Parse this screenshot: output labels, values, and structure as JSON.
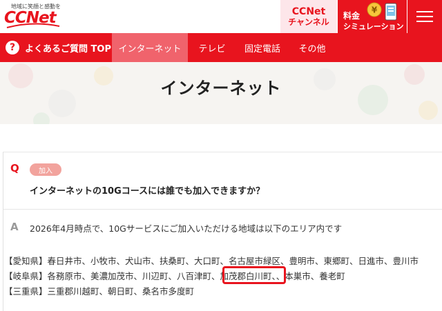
{
  "header": {
    "logo_tagline": "地域に笑顔と感動を",
    "logo_text": "CCNet",
    "channel_line1": "CCNet",
    "channel_line2": "チャンネル",
    "sim_line1": "料金",
    "sim_line2": "シミュレーション",
    "coin_symbol": "¥"
  },
  "nav": {
    "home_icon": "?",
    "home_label": "よくあるご質問 TOP",
    "items": [
      {
        "label": "インターネット",
        "active": true
      },
      {
        "label": "テレビ",
        "active": false
      },
      {
        "label": "固定電話",
        "active": false
      },
      {
        "label": "その他",
        "active": false
      }
    ]
  },
  "hero": {
    "title": "インターネット"
  },
  "faq": {
    "q_mark": "Q",
    "badge": "加入",
    "question": "インターネットの10Gコースには誰でも加入できますか？",
    "a_mark": "A",
    "answer": "2026年4月時点で、10Gサービスにご加入いただける地域は以下のエリア内です",
    "areas": [
      "【愛知県】春日井市、小牧市、犬山市、扶桑町、大口町、名古屋市緑区、豊明市、東郷町、日進市、豊川市",
      "【岐阜県】各務原市、美濃加茂市、川辺町、八百津町、加茂郡白川町、、本巣市、養老町",
      "【三重県】三重郡川越町、朝日町、桑名市多度町"
    ]
  },
  "colors": {
    "brand_red": "#e8141e",
    "nav_active": "#f0636c",
    "badge": "#f2a39d"
  }
}
